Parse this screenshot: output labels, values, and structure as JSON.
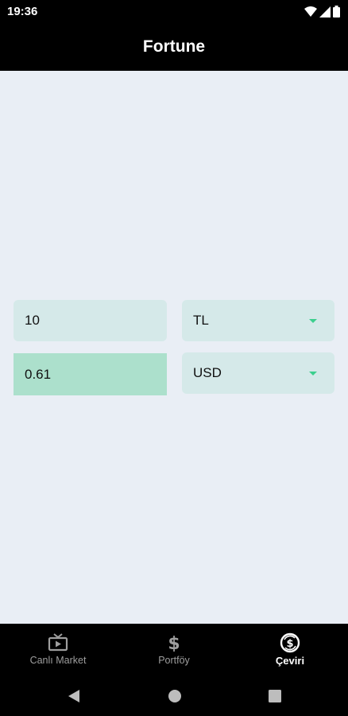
{
  "status": {
    "time": "19:36"
  },
  "app": {
    "title": "Fortune"
  },
  "converter": {
    "amount": "10",
    "from_currency": "TL",
    "result": "0.61",
    "to_currency": "USD"
  },
  "nav": {
    "items": [
      {
        "label": "Canlı Market",
        "icon": "tv-play-icon",
        "active": false
      },
      {
        "label": "Portföy",
        "icon": "dollar-icon",
        "active": false
      },
      {
        "label": "Çeviri",
        "icon": "currency-exchange-icon",
        "active": true
      }
    ]
  },
  "colors": {
    "app_bar": "#000000",
    "background": "#e9eef5",
    "input_fill": "#d5e9e9",
    "result_fill": "#ace0cc",
    "accent": "#3ccf8e"
  }
}
